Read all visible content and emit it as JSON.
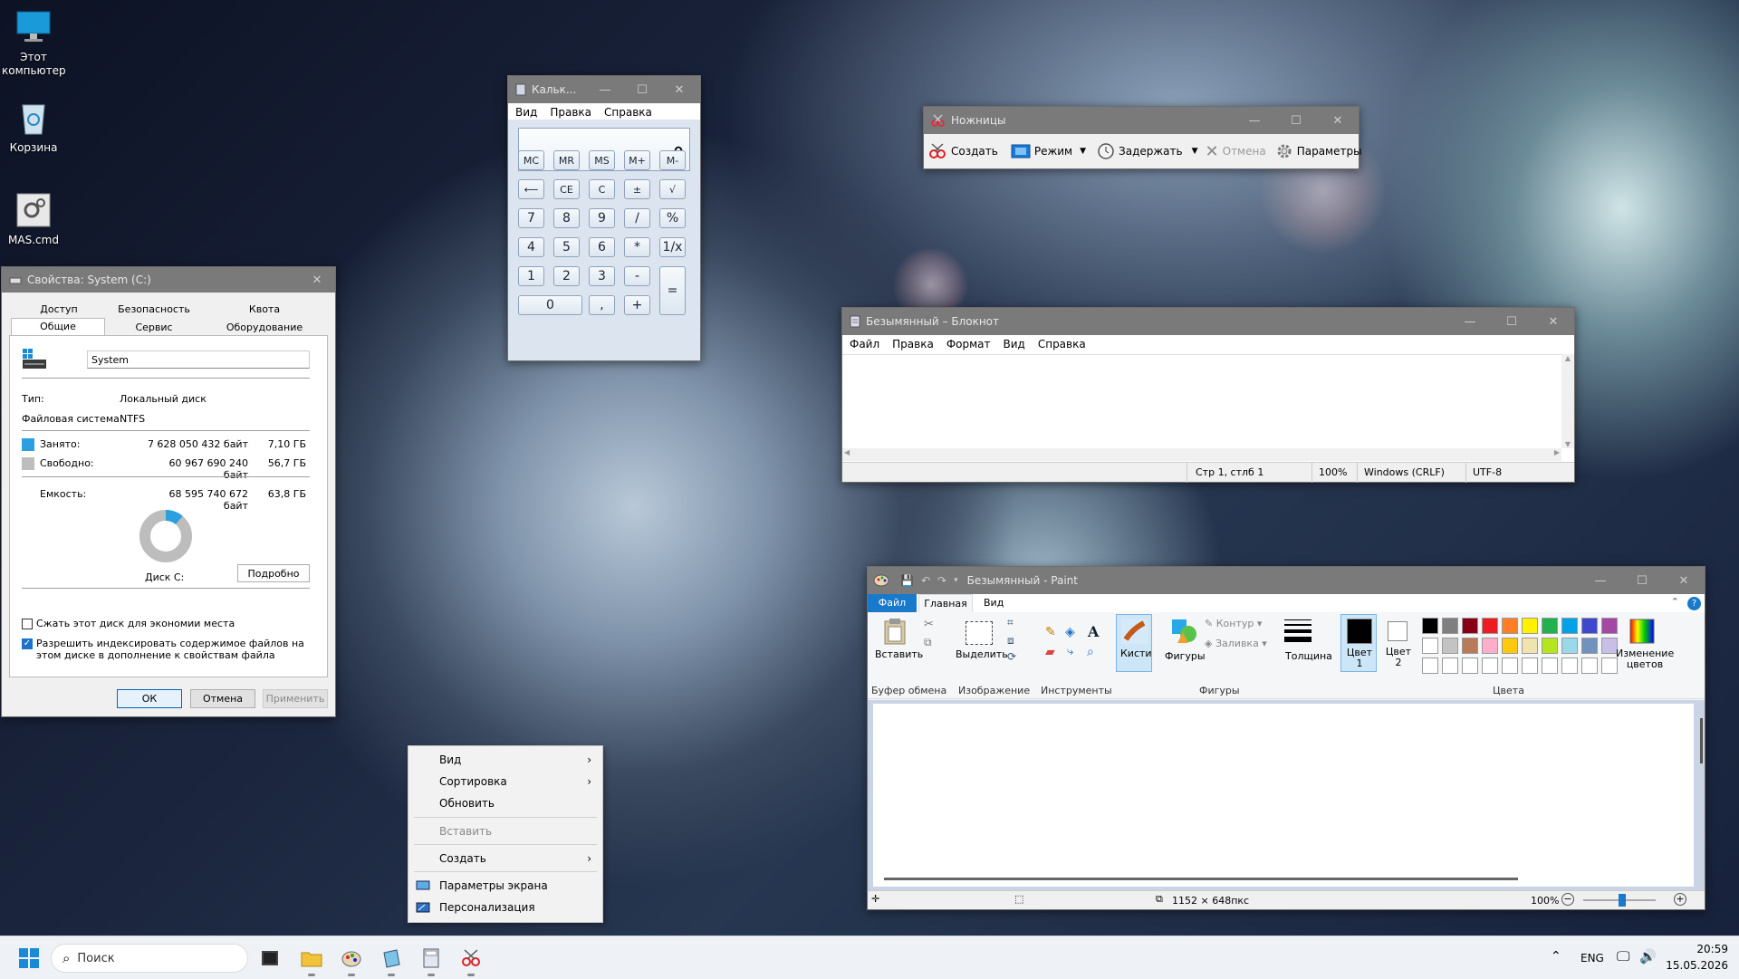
{
  "desktop": {
    "icons": [
      {
        "label": "Этот компьютер"
      },
      {
        "label": "Корзина"
      },
      {
        "label": "MAS.cmd"
      }
    ]
  },
  "calculator": {
    "title": "Кальк...",
    "menu": [
      "Вид",
      "Правка",
      "Справка"
    ],
    "display": "0",
    "memory": [
      "MC",
      "MR",
      "MS",
      "M+",
      "M-"
    ],
    "row2": [
      "⟵",
      "CE",
      "C",
      "±",
      "√"
    ],
    "row3": [
      "7",
      "8",
      "9",
      "/",
      "%"
    ],
    "row4": [
      "4",
      "5",
      "6",
      "*",
      "1/x"
    ],
    "row5": [
      "1",
      "2",
      "3",
      "-"
    ],
    "row6": [
      "0",
      ",",
      "+"
    ],
    "equals": "="
  },
  "snipping": {
    "title": "Ножницы",
    "create": "Создать",
    "mode": "Режим",
    "delay": "Задержать",
    "cancel": "Отмена",
    "options": "Параметры"
  },
  "properties": {
    "title": "Свойства: System (C:)",
    "tabs_top": [
      "Доступ",
      "Безопасность",
      "Квота"
    ],
    "tabs_bottom": [
      "Общие",
      "Сервис",
      "Оборудование"
    ],
    "name_value": "System",
    "type_label": "Тип:",
    "type_value": "Локальный диск",
    "fs_label": "Файловая система:",
    "fs_value": "NTFS",
    "used_label": "Занято:",
    "used_bytes": "7 628 050 432 байт",
    "used_gb": "7,10 ГБ",
    "free_label": "Свободно:",
    "free_bytes": "60 967 690 240 байт",
    "free_gb": "56,7 ГБ",
    "cap_label": "Емкость:",
    "cap_bytes": "68 595 740 672 байт",
    "cap_gb": "63,8 ГБ",
    "used_fraction": 0.111,
    "disk_label": "Диск C:",
    "details_btn": "Подробно",
    "compress_label": "Сжать этот диск для экономии места",
    "index_label": "Разрешить индексировать содержимое файлов на этом диске в дополнение к свойствам файла",
    "ok": "ОК",
    "cancel": "Отмена",
    "apply": "Применить",
    "used_color": "#2b9fe0",
    "free_color": "#bdbdbd"
  },
  "notepad": {
    "title": "Безымянный – Блокнот",
    "menu": [
      "Файл",
      "Правка",
      "Формат",
      "Вид",
      "Справка"
    ],
    "status_pos": "Стр 1, стлб 1",
    "status_zoom": "100%",
    "status_eol": "Windows (CRLF)",
    "status_enc": "UTF-8"
  },
  "paint": {
    "title": "Безымянный - Paint",
    "tabs": [
      "Файл",
      "Главная",
      "Вид"
    ],
    "paste": "Вставить",
    "select": "Выделить",
    "brushes": "Кисти",
    "shapes": "Фигуры",
    "outline": "Контур",
    "fill": "Заливка",
    "thickness": "Толщина",
    "color1": "Цвет 1",
    "color2": "Цвет 2",
    "edit_colors": "Изменение цветов",
    "groups": [
      "Буфер обмена",
      "Изображение",
      "Инструменты",
      "Фигуры",
      "Цвета"
    ],
    "size": "1152 × 648пкс",
    "zoom": "100%",
    "palette": [
      "#000000",
      "#7f7f7f",
      "#880015",
      "#ed1c24",
      "#ff7f27",
      "#fff200",
      "#22b14c",
      "#00a2e8",
      "#3f48cc",
      "#a349a4",
      "#ffffff",
      "#c3c3c3",
      "#b97a57",
      "#ffaec9",
      "#ffc90e",
      "#efe4b0",
      "#b5e61d",
      "#99d9ea",
      "#7092be",
      "#c8bfe7"
    ]
  },
  "context_menu": {
    "items": [
      "Вид",
      "Сортировка",
      "Обновить",
      "Вставить",
      "Создать",
      "Параметры экрана",
      "Персонализация"
    ]
  },
  "taskbar": {
    "search": "Поиск",
    "lang": "ENG",
    "time": "20:59",
    "date": "15.05.2026"
  }
}
